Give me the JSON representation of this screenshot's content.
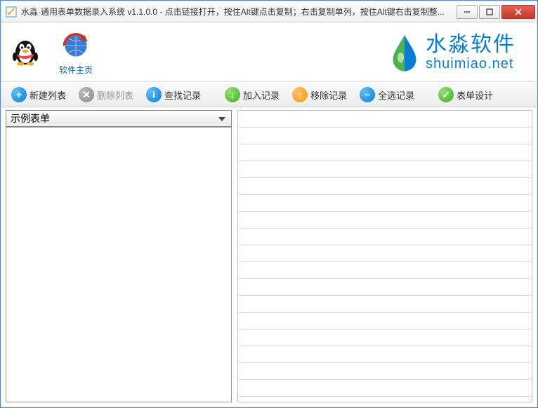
{
  "window": {
    "title": "水淼·通用表单数据录入系统 v1.1.0.0 - 点击链接打开，按住Alt键点击复制；右击复制单列，按住Alt键右击复制整..."
  },
  "launchers": {
    "qq": {
      "label": ""
    },
    "home": {
      "label": "软件主页"
    }
  },
  "brand": {
    "cn": "水淼软件",
    "en": "shuimiao.net"
  },
  "toolbar": {
    "new_list": "新建列表",
    "delete_list": "删除列表",
    "find_record": "查找记录",
    "add_record": "加入记录",
    "remove_record": "移除记录",
    "select_all": "全选记录",
    "form_design": "表单设计"
  },
  "combo": {
    "selected": "示例表单"
  },
  "grid": {
    "rows": 17
  }
}
